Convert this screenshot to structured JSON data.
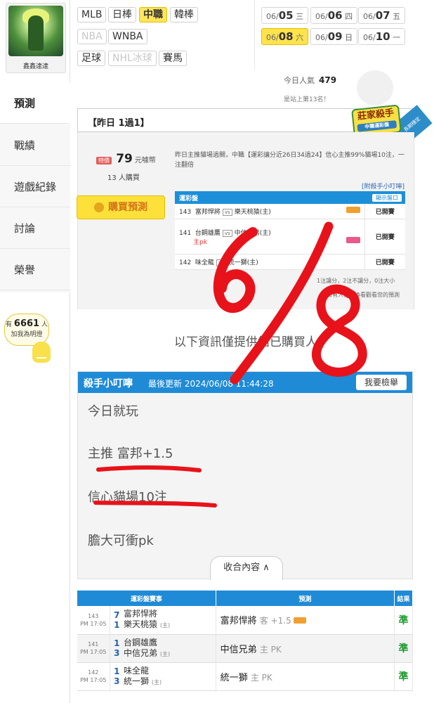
{
  "sidebar": {
    "username": "鑫鑫達達",
    "items": [
      "預測",
      "戰績",
      "遊戲紀錄",
      "討論",
      "榮譽"
    ],
    "hint_prefix": "有",
    "hint_count": "6661",
    "hint_suffix": "人",
    "hint_sub": "加我為明燈"
  },
  "leagues": {
    "row1": [
      "MLB",
      "日棒",
      "中職",
      "韓棒"
    ],
    "row2": [
      "NBA",
      "WNBA"
    ],
    "row3": [
      "足球",
      "NHL冰球",
      "賽馬"
    ]
  },
  "dates": [
    {
      "md": "06/",
      "d": "05",
      "w": "三"
    },
    {
      "md": "06/",
      "d": "06",
      "w": "四"
    },
    {
      "md": "06/",
      "d": "07",
      "w": "五"
    },
    {
      "md": "06/",
      "d": "08",
      "w": "六"
    },
    {
      "md": "06/",
      "d": "09",
      "w": "日"
    },
    {
      "md": "06/",
      "d": "10",
      "w": "一"
    }
  ],
  "popularity": {
    "label": "今日人氣",
    "value": "479"
  },
  "rank_text": "是站上第13名！",
  "week_result": "【昨日 1過1】",
  "badge": {
    "main": "莊家殺手",
    "sub": "中職運彩盤",
    "ribbon": "長期穩定"
  },
  "purchase": {
    "ticket": "特價",
    "price": "79",
    "unit": "元噱幣",
    "buyers": "13 人購買",
    "buy_button": "購買預測"
  },
  "summary": "昨日主推貓場過關，中職【運彩讓分近26日34過24】信心主推99%貓場10注，一注翻倍",
  "killer_link": "[附殺手小叮嚀]",
  "mini_table": {
    "header": "運彩盤",
    "show": "顯示盤口",
    "rows": [
      {
        "no": "143",
        "away": "富邦悍將",
        "home": "樂天桃猿(主)",
        "note": "",
        "result": "已開賽"
      },
      {
        "no": "141",
        "away": "台鋼雄鷹",
        "home": "中信兄弟(主)",
        "note": "主pk",
        "result": "已開賽"
      },
      {
        "no": "142",
        "away": "味全龍",
        "home": "統一獅(主)",
        "note": "",
        "result": "已開賽"
      }
    ],
    "vs": "vs"
  },
  "stats_note": "1注讓分，2注不讓分，0注大小",
  "stats_note2": "今日有人已兒換看觀看您的預測",
  "info_message": "以下資訊僅提供給已購買人",
  "killer_panel": {
    "title": "殺手小叮嚀",
    "updated": "最後更新 2024/06/08 11:44:28",
    "report": "我要檢舉",
    "lines": [
      "今日就玩",
      "主推 富邦+1.5",
      "信心貓場10注",
      "膽大可衝pk"
    ],
    "collapse": "收合內容 ∧"
  },
  "result_table": {
    "headers": [
      "運彩盤賽事",
      "預測",
      "結果"
    ],
    "rows": [
      {
        "no": "143",
        "time": "PM 17:05",
        "s1": "7",
        "s2": "1",
        "t1": "富邦悍將",
        "t2": "樂天桃猿",
        "side": "(主)",
        "pick": "富邦悍將",
        "odds": "客 +1.5",
        "result": "準"
      },
      {
        "no": "141",
        "time": "PM 17:05",
        "s1": "1",
        "s2": "3",
        "t1": "台鋼雄鷹",
        "t2": "中信兄弟",
        "side": "(主)",
        "pick": "中信兄弟",
        "odds": "主 PK",
        "result": "準"
      },
      {
        "no": "142",
        "time": "PM 17:05",
        "s1": "1",
        "s2": "3",
        "t1": "味全龍",
        "t2": "統一獅",
        "side": "(主)",
        "pick": "統一獅",
        "odds": "主 PK",
        "result": "準"
      }
    ]
  },
  "handwriting": "6/8",
  "colors": {
    "accent": "#1f8bd6",
    "highlight": "#ffe34d",
    "ink": "#e8121a",
    "hit": "#1a9a2a"
  }
}
